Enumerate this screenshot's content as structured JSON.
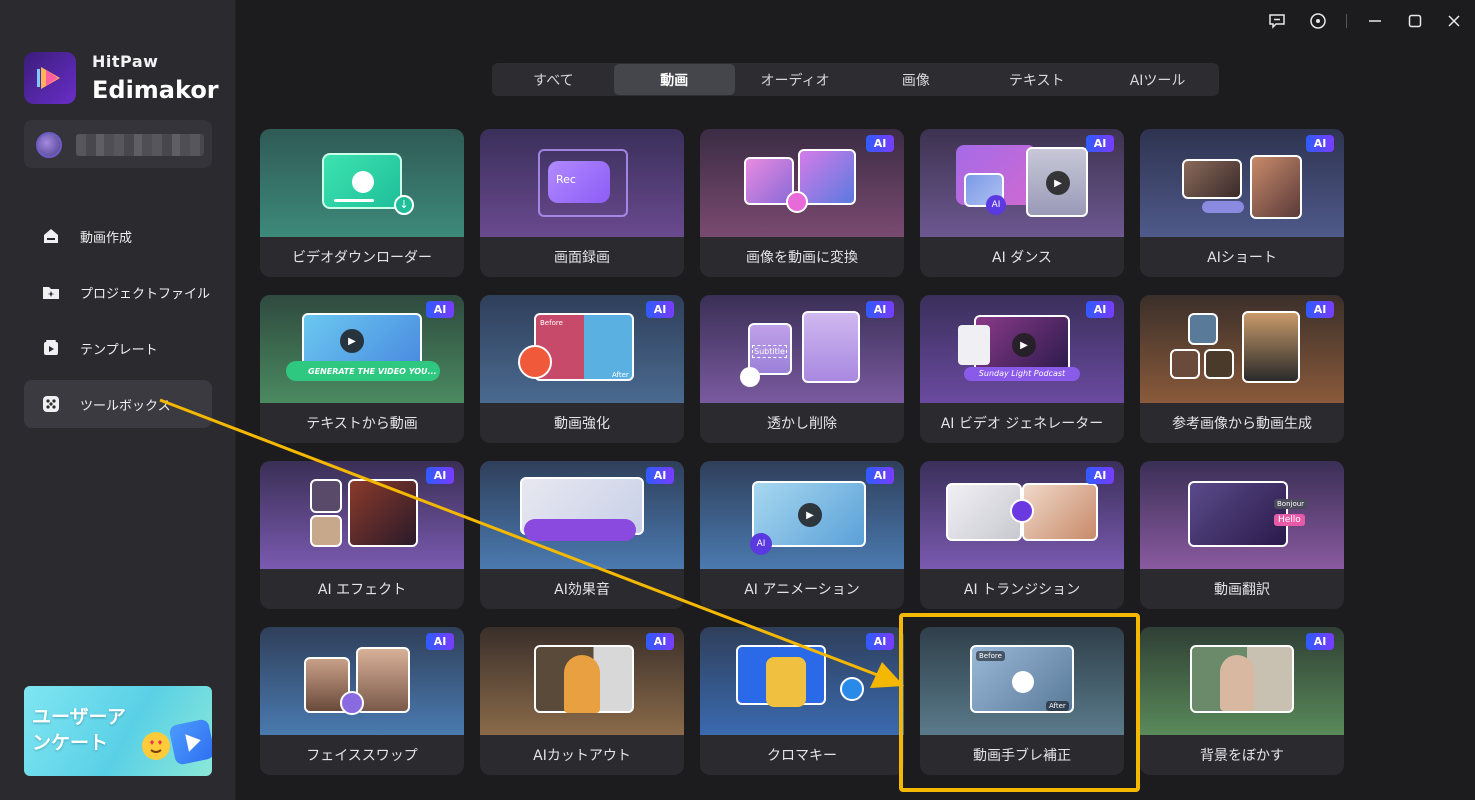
{
  "app": {
    "brand_top": "HitPaw",
    "brand_main": "Edimakor"
  },
  "window_controls": [
    "feedback-icon",
    "settings-icon",
    "minimize-icon",
    "maximize-icon",
    "close-icon"
  ],
  "sidebar": {
    "items": [
      {
        "label": "動画作成",
        "icon": "home-icon"
      },
      {
        "label": "プロジェクトファイル",
        "icon": "folder-icon"
      },
      {
        "label": "テンプレート",
        "icon": "template-icon"
      },
      {
        "label": "ツールボックス",
        "icon": "toolbox-icon"
      }
    ],
    "active_index": 3,
    "survey_banner": "ユーザーアンケート"
  },
  "tabs": {
    "items": [
      "すべて",
      "動画",
      "オーディオ",
      "画像",
      "テキスト",
      "AIツール"
    ],
    "active_index": 1
  },
  "ai_badge_label": "AI",
  "tools": [
    {
      "label": "ビデオダウンローダー",
      "ai": false
    },
    {
      "label": "画面録画",
      "ai": false
    },
    {
      "label": "画像を動画に変換",
      "ai": true
    },
    {
      "label": "AI ダンス",
      "ai": true
    },
    {
      "label": "AIショート",
      "ai": true
    },
    {
      "label": "テキストから動画",
      "ai": true
    },
    {
      "label": "動画強化",
      "ai": true
    },
    {
      "label": "透かし削除",
      "ai": true
    },
    {
      "label": "AI ビデオ ジェネレーター",
      "ai": true
    },
    {
      "label": "参考画像から動画生成",
      "ai": true
    },
    {
      "label": "AI エフェクト",
      "ai": true
    },
    {
      "label": "AI効果音",
      "ai": true
    },
    {
      "label": "AI アニメーション",
      "ai": true
    },
    {
      "label": "AI トランジション",
      "ai": true
    },
    {
      "label": "動画翻訳",
      "ai": false
    },
    {
      "label": "フェイススワップ",
      "ai": true
    },
    {
      "label": "AIカットアウト",
      "ai": true
    },
    {
      "label": "クロマキー",
      "ai": true
    },
    {
      "label": "動画手ブレ補正",
      "ai": false
    },
    {
      "label": "背景をぼかす",
      "ai": true
    }
  ],
  "thumb_text": {
    "rec": "Rec",
    "subtitle": "Subtitle",
    "generate": "GENERATE THE VIDEO YOU...",
    "podcast": "Sunday Light Podcast",
    "before": "Before",
    "after": "After",
    "hello": "Hello",
    "bonjour": "Bonjour"
  },
  "highlighted_tool": "動画手ブレ補正",
  "colors": {
    "accent_yellow": "#f5b800",
    "ai_badge_start": "#2f5cff",
    "ai_badge_end": "#7a3cff"
  }
}
